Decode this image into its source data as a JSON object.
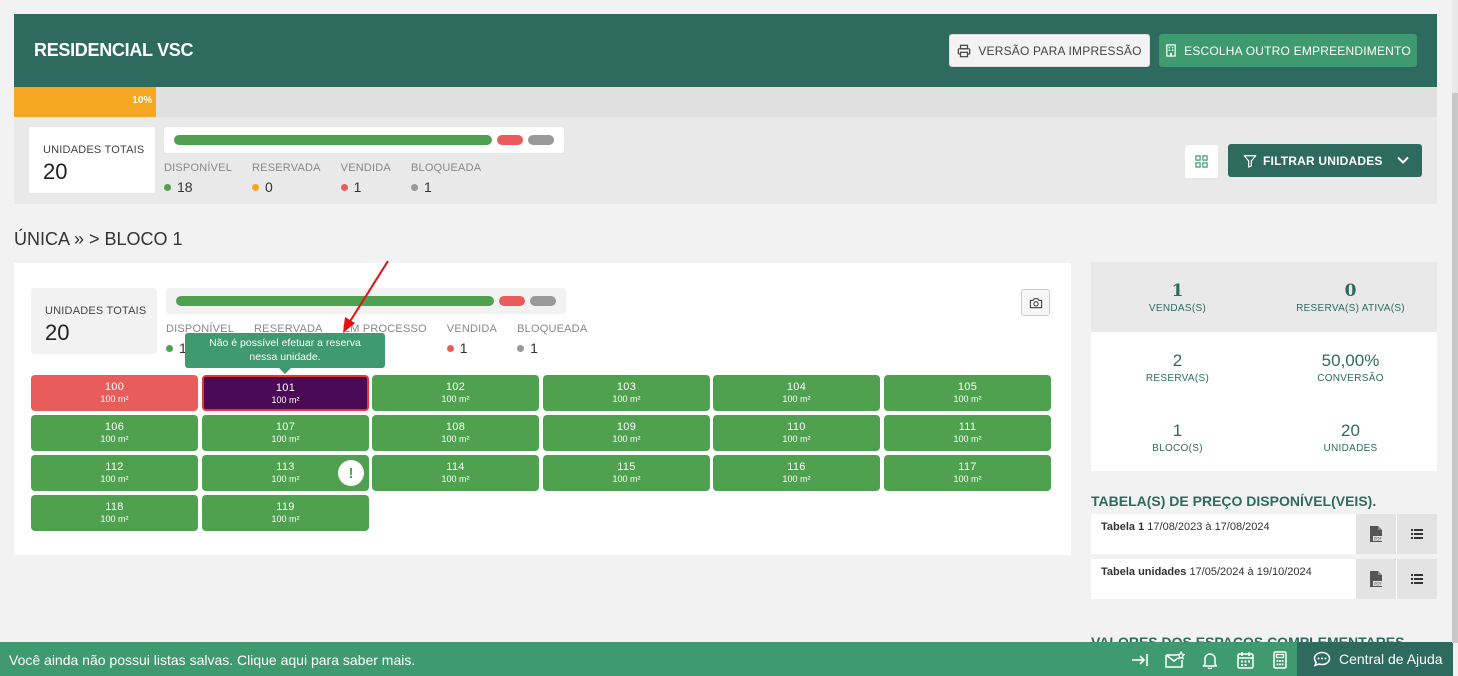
{
  "header": {
    "title": "RESIDENCIAL VSC",
    "print_label": "VERSÃO PARA IMPRESSÃO",
    "other_label": "ESCOLHA OUTRO EMPREENDIMENTO"
  },
  "progress": {
    "label": "10%",
    "value": 0.1,
    "color": "#f5a623"
  },
  "summary": {
    "total_label": "UNIDADES TOTAIS",
    "total_value": "20",
    "legend": [
      {
        "label": "DISPONÍVEL",
        "value": "18",
        "color": "#4fa14f"
      },
      {
        "label": "RESERVADA",
        "value": "0",
        "color": "#f5a623"
      },
      {
        "label": "VENDIDA",
        "value": "1",
        "color": "#e85c5c"
      },
      {
        "label": "BLOQUEADA",
        "value": "1",
        "color": "#999999"
      }
    ],
    "filter_label": "FILTRAR UNIDADES"
  },
  "breadcrumb": "ÚNICA » > BLOCO 1",
  "block": {
    "total_label": "UNIDADES TOTAIS",
    "total_value": "20",
    "legend": [
      {
        "label": "DISPONÍVEL",
        "value": "1",
        "color": "#4fa14f"
      },
      {
        "label": "RESERVADA",
        "value": "",
        "color": "#f5a623"
      },
      {
        "label": "EM PROCESSO",
        "value": "",
        "color": "#3a7bd5"
      },
      {
        "label": "VENDIDA",
        "value": "1",
        "color": "#e85c5c"
      },
      {
        "label": "BLOQUEADA",
        "value": "1",
        "color": "#999999"
      }
    ]
  },
  "tooltip": {
    "line1": "Não é possível efetuar a reserva",
    "line2": "nessa unidade."
  },
  "units": [
    {
      "number": "100",
      "area": "100 m²",
      "status": "sold"
    },
    {
      "number": "101",
      "area": "100 m²",
      "status": "selected"
    },
    {
      "number": "102",
      "area": "100 m²",
      "status": "avail"
    },
    {
      "number": "103",
      "area": "100 m²",
      "status": "avail"
    },
    {
      "number": "104",
      "area": "100 m²",
      "status": "avail"
    },
    {
      "number": "105",
      "area": "100 m²",
      "status": "avail"
    },
    {
      "number": "106",
      "area": "100 m²",
      "status": "avail"
    },
    {
      "number": "107",
      "area": "100 m²",
      "status": "avail"
    },
    {
      "number": "108",
      "area": "100 m²",
      "status": "avail"
    },
    {
      "number": "109",
      "area": "100 m²",
      "status": "avail"
    },
    {
      "number": "110",
      "area": "100 m²",
      "status": "avail"
    },
    {
      "number": "111",
      "area": "100 m²",
      "status": "avail"
    },
    {
      "number": "112",
      "area": "100 m²",
      "status": "avail"
    },
    {
      "number": "113",
      "area": "100 m²",
      "status": "avail",
      "warning": "!"
    },
    {
      "number": "114",
      "area": "100 m²",
      "status": "avail"
    },
    {
      "number": "115",
      "area": "100 m²",
      "status": "avail"
    },
    {
      "number": "116",
      "area": "100 m²",
      "status": "avail"
    },
    {
      "number": "117",
      "area": "100 m²",
      "status": "avail"
    },
    {
      "number": "118",
      "area": "100 m²",
      "status": "avail"
    },
    {
      "number": "119",
      "area": "100 m²",
      "status": "avail"
    }
  ],
  "stats": {
    "vendas": {
      "value": "1",
      "label": "VENDAS(S)"
    },
    "reservas_ativas": {
      "value": "0",
      "label": "RESERVA(S) ATIVA(S)"
    },
    "reservas": {
      "value": "2",
      "label": "RESERVA(S)"
    },
    "conversao": {
      "value": "50,00%",
      "label": "CONVERSÃO"
    },
    "blocos": {
      "value": "1",
      "label": "BLOCO(S)"
    },
    "unidades": {
      "value": "20",
      "label": "UNIDADES"
    }
  },
  "price_tables": {
    "title": "TABELA(S) DE PREÇO DISPONÍVEL(VEIS).",
    "rows": [
      {
        "name": "Tabela 1",
        "period": "17/08/2023 à 17/08/2024"
      },
      {
        "name": "Tabela unidades",
        "period": "17/05/2024 à 19/10/2024"
      }
    ],
    "pdf_icon": "pdf-icon",
    "list_icon": "list-icon"
  },
  "extra_title": "VALORES DOS ESPAÇOS COMPLEMENTARES",
  "footer": {
    "message": "Você ainda não possui listas salvas. Clique aqui para saber mais.",
    "help_label": "Central de Ajuda"
  }
}
